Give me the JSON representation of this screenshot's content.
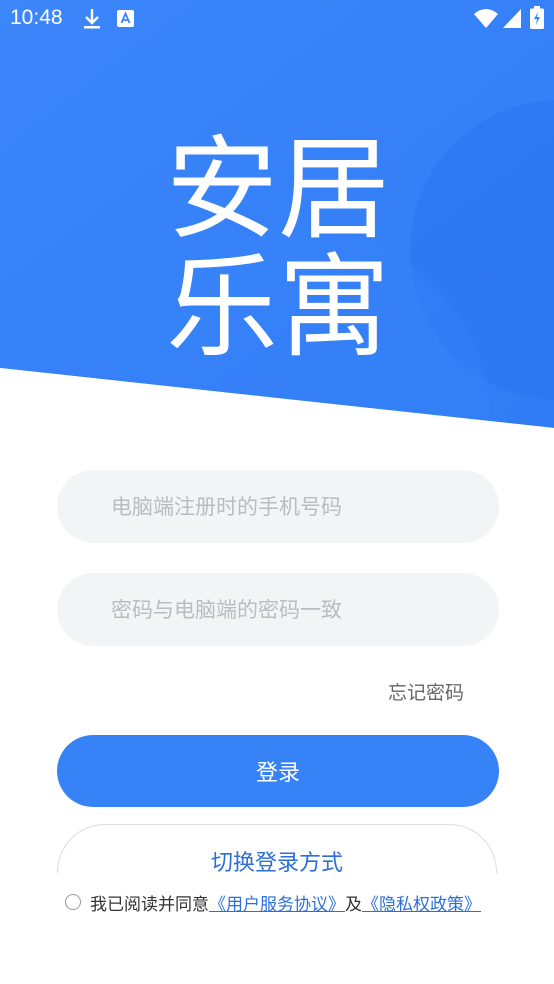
{
  "status_bar": {
    "time": "10:48"
  },
  "logo": {
    "line1": "安居",
    "line2": "乐寓"
  },
  "colors": {
    "primary": "#3683f7",
    "link": "#2d6fd8"
  },
  "form": {
    "phone_placeholder": "电脑端注册时的手机号码",
    "password_placeholder": "密码与电脑端的密码一致",
    "forgot_label": "忘记密码",
    "login_label": "登录",
    "switch_label": "切换登录方式"
  },
  "agreement": {
    "prefix": "我已阅读并同意",
    "user_service": "《用户服务协议》",
    "and": "及",
    "privacy": "《隐私权政策》"
  }
}
